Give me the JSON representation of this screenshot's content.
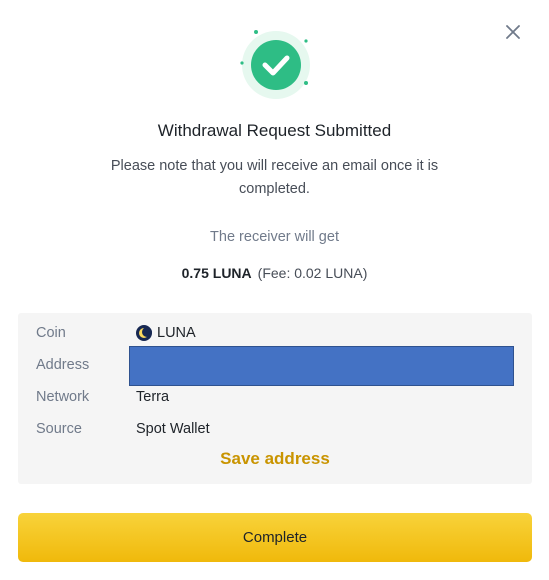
{
  "dialog": {
    "title": "Withdrawal Request Submitted",
    "subtitle": "Please note that you will receive an email once it is completed.",
    "receiver_label": "The receiver will get",
    "amount": "0.75 LUNA",
    "fee": "(Fee: 0.02 LUNA)",
    "close_icon": "close-icon",
    "status_icon": "check-circle-icon"
  },
  "details": {
    "coin": {
      "label": "Coin",
      "value": "LUNA",
      "icon": "luna-coin-icon"
    },
    "address": {
      "label": "Address",
      "value": ""
    },
    "network": {
      "label": "Network",
      "value": "Terra"
    },
    "source": {
      "label": "Source",
      "value": "Spot Wallet"
    },
    "save_address": "Save address"
  },
  "actions": {
    "complete_label": "Complete"
  },
  "colors": {
    "accent": "#f0b90b",
    "link": "#c99400",
    "success": "#0ecb81",
    "redaction": "#4472c4"
  }
}
